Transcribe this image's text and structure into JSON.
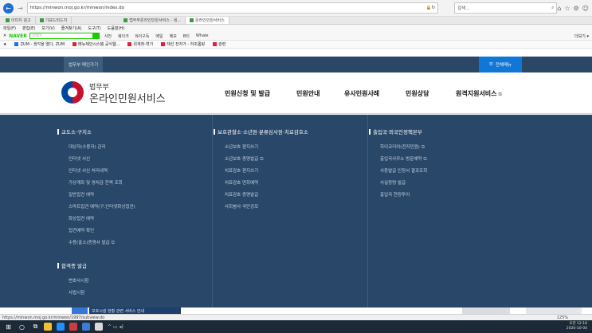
{
  "browser": {
    "url": "https://minwon.moj.go.kr/minwon/index.do",
    "search_placeholder": "검색...",
    "tabs": [
      {
        "label": "이미지 검고"
      },
      {
        "label": "기묘드리드지"
      },
      {
        "label": "법무부온라인민원서비스 · 네..."
      },
      {
        "label": "온라인민원서비스"
      }
    ],
    "menu": [
      "파일(F)",
      "편집(E)",
      "보기(V)",
      "즐겨찾기(A)",
      "도구(T)",
      "도움말(H)"
    ],
    "naver": {
      "logo": "NAVER",
      "placeholder": "검색어",
      "items": [
        "사전",
        "웨이크",
        "N이구독",
        "메일",
        "메모",
        "B티",
        "Whale"
      ],
      "right": "더보기 ▾"
    },
    "favorites": [
      "ZUM - 생각을 열다, ZUM",
      "메뉴제안시스템 공식웹...",
      "위계좌-혁가",
      "재선 전자가 - 하조롬랑",
      "관련"
    ],
    "status_url": "https://minwon.moj.go.kr/minwon/1997/subview.do",
    "zoom": "125%"
  },
  "site": {
    "old_site_label": "법무부 메인가기",
    "all_menu_label": "전체메뉴",
    "brand_sub": "법무부",
    "brand_main": "온라인민원서비스",
    "gnb": [
      "민원신청 및 발급",
      "민원안내",
      "유사민원사례",
      "민원상담",
      "원격지원서비스"
    ]
  },
  "mega": {
    "col1": {
      "title": "교도소·구치소",
      "links": [
        "대상자(수용자) 관리",
        "인터넷 서신",
        "인터넷 서신 처리내역",
        "가상계좌 및 영치금 잔액 조회",
        "일반접견 예약",
        "스마트접견 예약(구.인터넷화상접견)",
        "화상접견 예약",
        "접견예약 확인",
        "수용(출소)증명서 발급"
      ],
      "title2": "합격증 발급",
      "links2": [
        "변호사시험",
        "사법시험"
      ]
    },
    "col2": {
      "title": "보호관찰소·소년원·분류심사원·치료감호소",
      "links": [
        "소년보호 편지쓰기",
        "소년보호 증명발급",
        "치료감호 편지쓰기",
        "치료감호 면회예약",
        "치료감호 증명발급",
        "사회봉사 국민공모"
      ]
    },
    "col3": {
      "title": "출입국·외국인정책본부",
      "links": [
        "하이코리아(전자민원)",
        "출입국사무소 방문예약",
        "사증발급 인정서 결과조회",
        "사실증명 발급",
        "출입국 현장투어"
      ]
    },
    "promo": "보호시설 현황 관련 서비스 안내"
  },
  "taskbar": {
    "time": "오전 12:16",
    "date": "2020-10-04"
  }
}
